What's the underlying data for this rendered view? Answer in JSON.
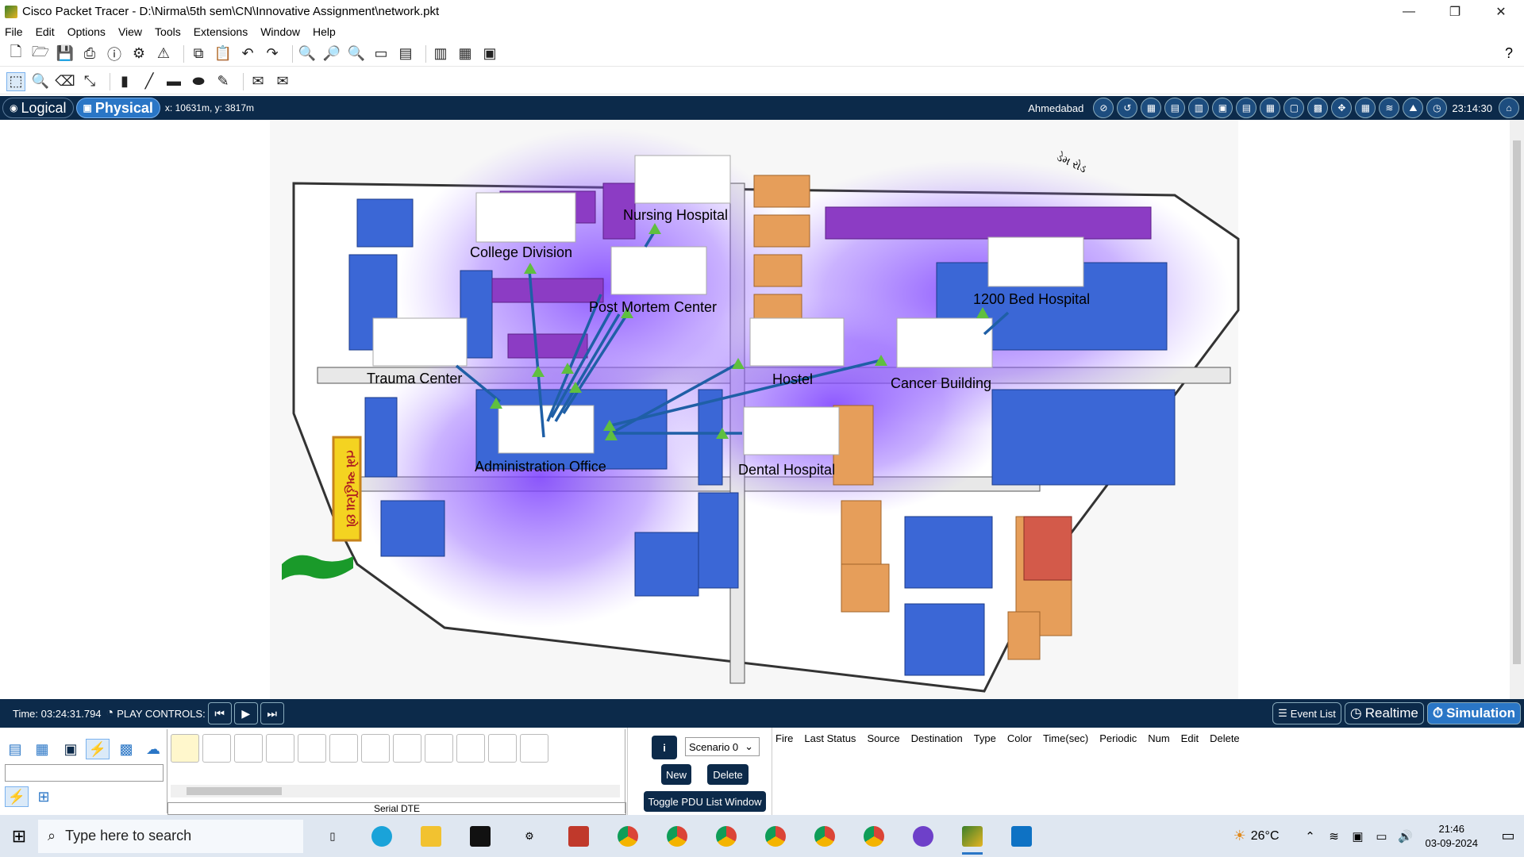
{
  "window": {
    "title": "Cisco Packet Tracer - D:\\Nirma\\5th sem\\CN\\Innovative Assignment\\network.pkt",
    "minimize": "—",
    "restore": "❐",
    "close": "✕"
  },
  "menu": [
    "File",
    "Edit",
    "Options",
    "View",
    "Tools",
    "Extensions",
    "Window",
    "Help"
  ],
  "workspace": {
    "logical_tab": "Logical",
    "physical_tab": "Physical",
    "coordinates": "x: 10631m, y: 3817m",
    "location": "Ahmedabad",
    "clock": "23:14:30"
  },
  "map": {
    "labels": [
      "Nursing Hospital",
      "College Division",
      "Post Mortem Center",
      "1200 Bed Hospital",
      "Trauma Center",
      "Hostel",
      "Cancer Building",
      "Administration Office",
      "Dental Hospital"
    ],
    "road_label_1": "ડેમ રોડ",
    "vertical_banner": "તમે અહીંયા છો"
  },
  "simbar": {
    "time": "Time: 03:24:31.794",
    "play_controls": "PLAY CONTROLS:",
    "event_list": "Event List",
    "realtime": "Realtime",
    "simulation": "Simulation"
  },
  "devices": {
    "connection_label": "Serial DTE"
  },
  "scenario": {
    "selected": "Scenario 0",
    "new": "New",
    "delete": "Delete",
    "toggle": "Toggle PDU List Window"
  },
  "pdu_columns": [
    "Fire",
    "Last Status",
    "Source",
    "Destination",
    "Type",
    "Color",
    "Time(sec)",
    "Periodic",
    "Num",
    "Edit",
    "Delete"
  ],
  "taskbar": {
    "search_placeholder": "Type here to search",
    "temperature": "26°C",
    "time": "21:46",
    "date": "03-09-2024"
  }
}
